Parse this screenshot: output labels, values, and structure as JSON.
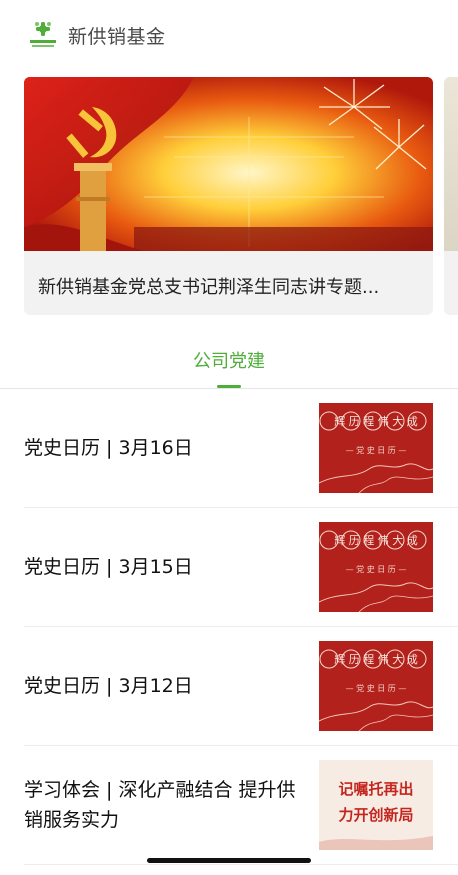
{
  "header": {
    "account_name": "新供销基金",
    "logo_icon": "xingongxiao-logo-icon",
    "brand_color": "#4fae3a"
  },
  "banner": {
    "caption": "新供销基金党总支书记荆泽生同志讲专题...",
    "image": "party-emblem-hall-with-fireworks"
  },
  "tabs": {
    "active_label": "公司党建",
    "active_color": "#4fae3a"
  },
  "articles": [
    {
      "title": "党史日历 | 3月16日",
      "thumb_top_text": "辉 历 程 伟 大 成",
      "thumb_sub_text": "— 党 史 日 历 —"
    },
    {
      "title": "党史日历 | 3月15日",
      "thumb_top_text": "辉 历 程 伟 大 成",
      "thumb_sub_text": "— 党 史 日 历 —"
    },
    {
      "title": "党史日历 | 3月12日",
      "thumb_top_text": "辉 历 程 伟 大 成",
      "thumb_sub_text": "— 党 史 日 历 —"
    },
    {
      "title": "学习体会 | 深化产融结合 提升供销服务实力",
      "thumb_line1": "记嘱托再出",
      "thumb_line2": "力开创新局"
    }
  ]
}
